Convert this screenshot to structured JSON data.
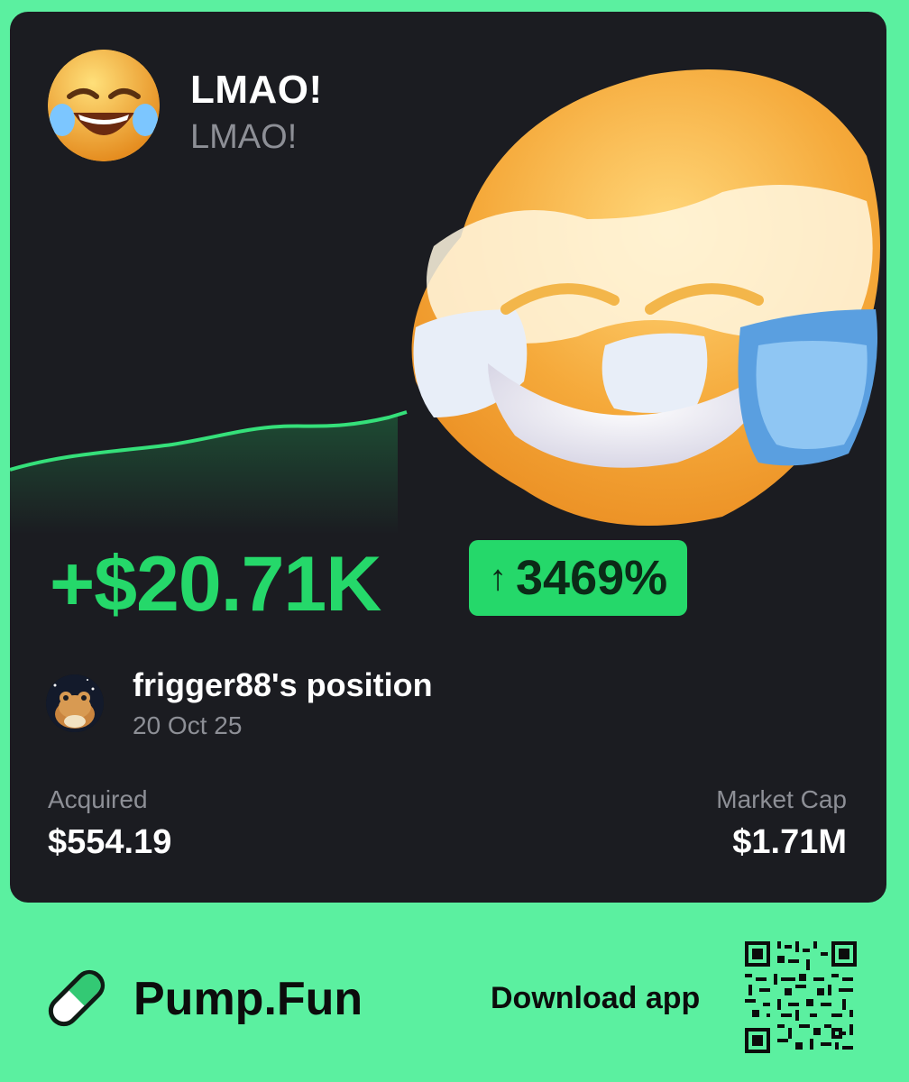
{
  "token": {
    "name": "LMAO!",
    "ticker": "LMAO!"
  },
  "pnl": {
    "profit": "+$20.71K",
    "arrow": "↑",
    "percent": "3469%"
  },
  "user": {
    "title": "frigger88's position",
    "date": "20 Oct 25"
  },
  "stats": {
    "acquired_label": "Acquired",
    "acquired_value": "$554.19",
    "market_cap_label": "Market Cap",
    "market_cap_value": "$1.71M"
  },
  "footer": {
    "brand": "Pump.Fun",
    "download": "Download app"
  },
  "colors": {
    "background": "#5bf0a0",
    "card": "#1b1c21",
    "accent_green": "#25d86a",
    "muted_text": "#8d8f96",
    "emoji_yellow": "#f6b43a"
  },
  "icons": [
    "laughing-emoji-avatar",
    "frog-avatar",
    "pill-logo-icon",
    "qr-code"
  ]
}
